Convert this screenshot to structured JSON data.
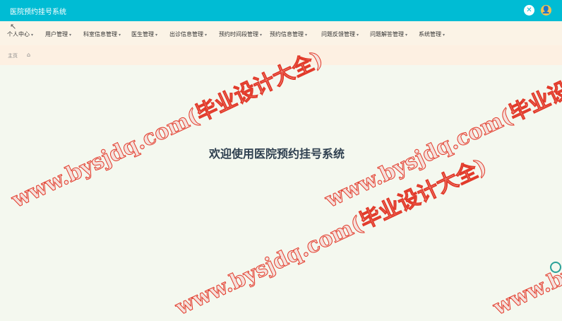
{
  "header": {
    "title": "医院预约挂号系统",
    "close_icon": "✕",
    "user_icon": "👤"
  },
  "nav": {
    "caret": "▾",
    "items": [
      {
        "label": "个人中心"
      },
      {
        "label": "用户管理"
      },
      {
        "label": "科室信息管理"
      },
      {
        "label": "医生管理"
      },
      {
        "label": "出诊信息管理"
      },
      {
        "label": "预约时间段管理"
      },
      {
        "label": "预约信息管理"
      },
      {
        "label": "问题反馈管理"
      },
      {
        "label": "问题解答管理"
      },
      {
        "label": "系统管理"
      }
    ]
  },
  "breadcrumb": {
    "home": "主页",
    "home_icon": "⌂"
  },
  "main": {
    "welcome": "欢迎使用医院预约挂号系统"
  },
  "watermarks": [
    "www.bysjdq.com(毕业设计大全)",
    "www.bysjdq.com(毕业设计大全)",
    "www.bysjdq.com(毕业设计大全)",
    "www.bysjdq.com(毕业设计大全)"
  ],
  "colors": {
    "header": "#00bcd4",
    "nav": "#fbf3e6",
    "welcome_text": "#2f4050",
    "watermark": "#e23a2a"
  }
}
